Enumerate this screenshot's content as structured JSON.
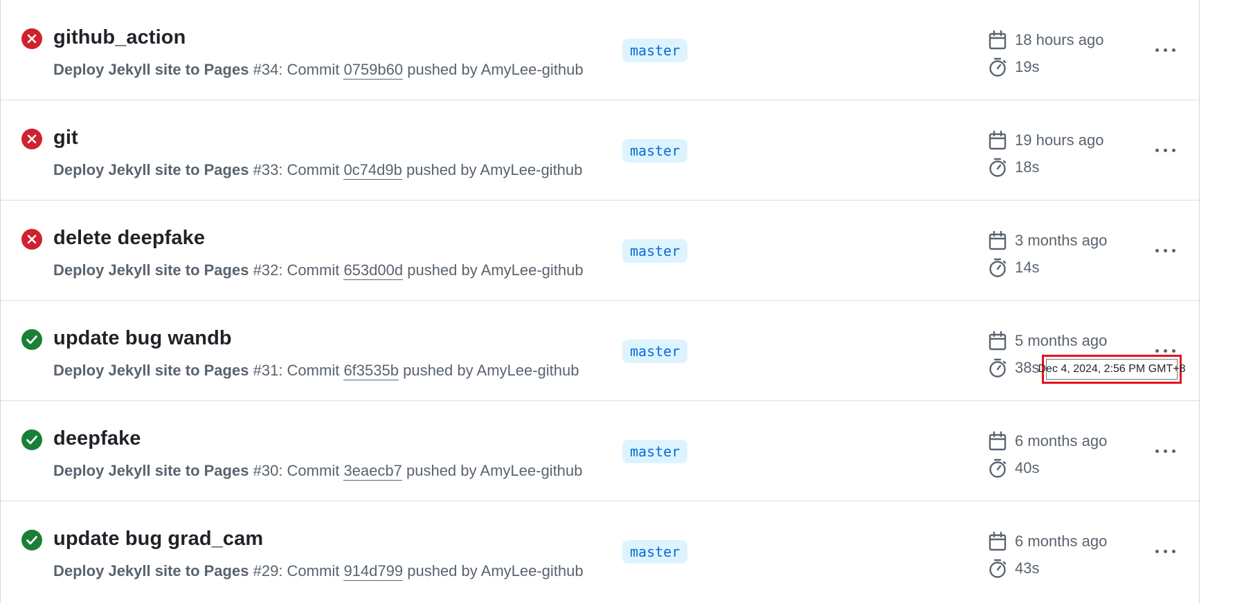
{
  "colors": {
    "failure": "#cf222e",
    "success": "#1a7f37",
    "branch_bg": "#ddf4ff",
    "branch_text": "#0969da",
    "muted_text": "#59636e",
    "tooltip_highlight": "#e3141b"
  },
  "runs": [
    {
      "status": "failure",
      "status_icon": "x-circle-fill-icon",
      "title": "github_action",
      "workflow": "Deploy Jekyll site to Pages",
      "run_number": "#34",
      "commit_prefix": ": Commit",
      "sha": "0759b60",
      "pushed_by": "pushed by AmyLee-github",
      "branch": "master",
      "date": "18 hours ago",
      "duration": "19s"
    },
    {
      "status": "failure",
      "status_icon": "x-circle-fill-icon",
      "title": "git",
      "workflow": "Deploy Jekyll site to Pages",
      "run_number": "#33",
      "commit_prefix": ": Commit",
      "sha": "0c74d9b",
      "pushed_by": "pushed by AmyLee-github",
      "branch": "master",
      "date": "19 hours ago",
      "duration": "18s"
    },
    {
      "status": "failure",
      "status_icon": "x-circle-fill-icon",
      "title": "delete deepfake",
      "workflow": "Deploy Jekyll site to Pages",
      "run_number": "#32",
      "commit_prefix": ": Commit",
      "sha": "653d00d",
      "pushed_by": "pushed by AmyLee-github",
      "branch": "master",
      "date": "3 months ago",
      "duration": "14s"
    },
    {
      "status": "success",
      "status_icon": "check-circle-fill-icon",
      "title": "update bug wandb",
      "workflow": "Deploy Jekyll site to Pages",
      "run_number": "#31",
      "commit_prefix": ": Commit",
      "sha": "6f3535b",
      "pushed_by": "pushed by AmyLee-github",
      "branch": "master",
      "date": "5 months ago",
      "duration": "38s"
    },
    {
      "status": "success",
      "status_icon": "check-circle-fill-icon",
      "title": "deepfake",
      "workflow": "Deploy Jekyll site to Pages",
      "run_number": "#30",
      "commit_prefix": ": Commit",
      "sha": "3eaecb7",
      "pushed_by": "pushed by AmyLee-github",
      "branch": "master",
      "date": "6 months ago",
      "duration": "40s"
    },
    {
      "status": "success",
      "status_icon": "check-circle-fill-icon",
      "title": "update bug grad_cam",
      "workflow": "Deploy Jekyll site to Pages",
      "run_number": "#29",
      "commit_prefix": ": Commit",
      "sha": "914d799",
      "pushed_by": "pushed by AmyLee-github",
      "branch": "master",
      "date": "6 months ago",
      "duration": "43s"
    }
  ],
  "icons": {
    "date": "calendar-icon",
    "duration": "stopwatch-icon",
    "menu": "kebab-horizontal-icon"
  },
  "tooltip": {
    "text": "Dec 4, 2024, 2:56 PM GMT+8"
  }
}
